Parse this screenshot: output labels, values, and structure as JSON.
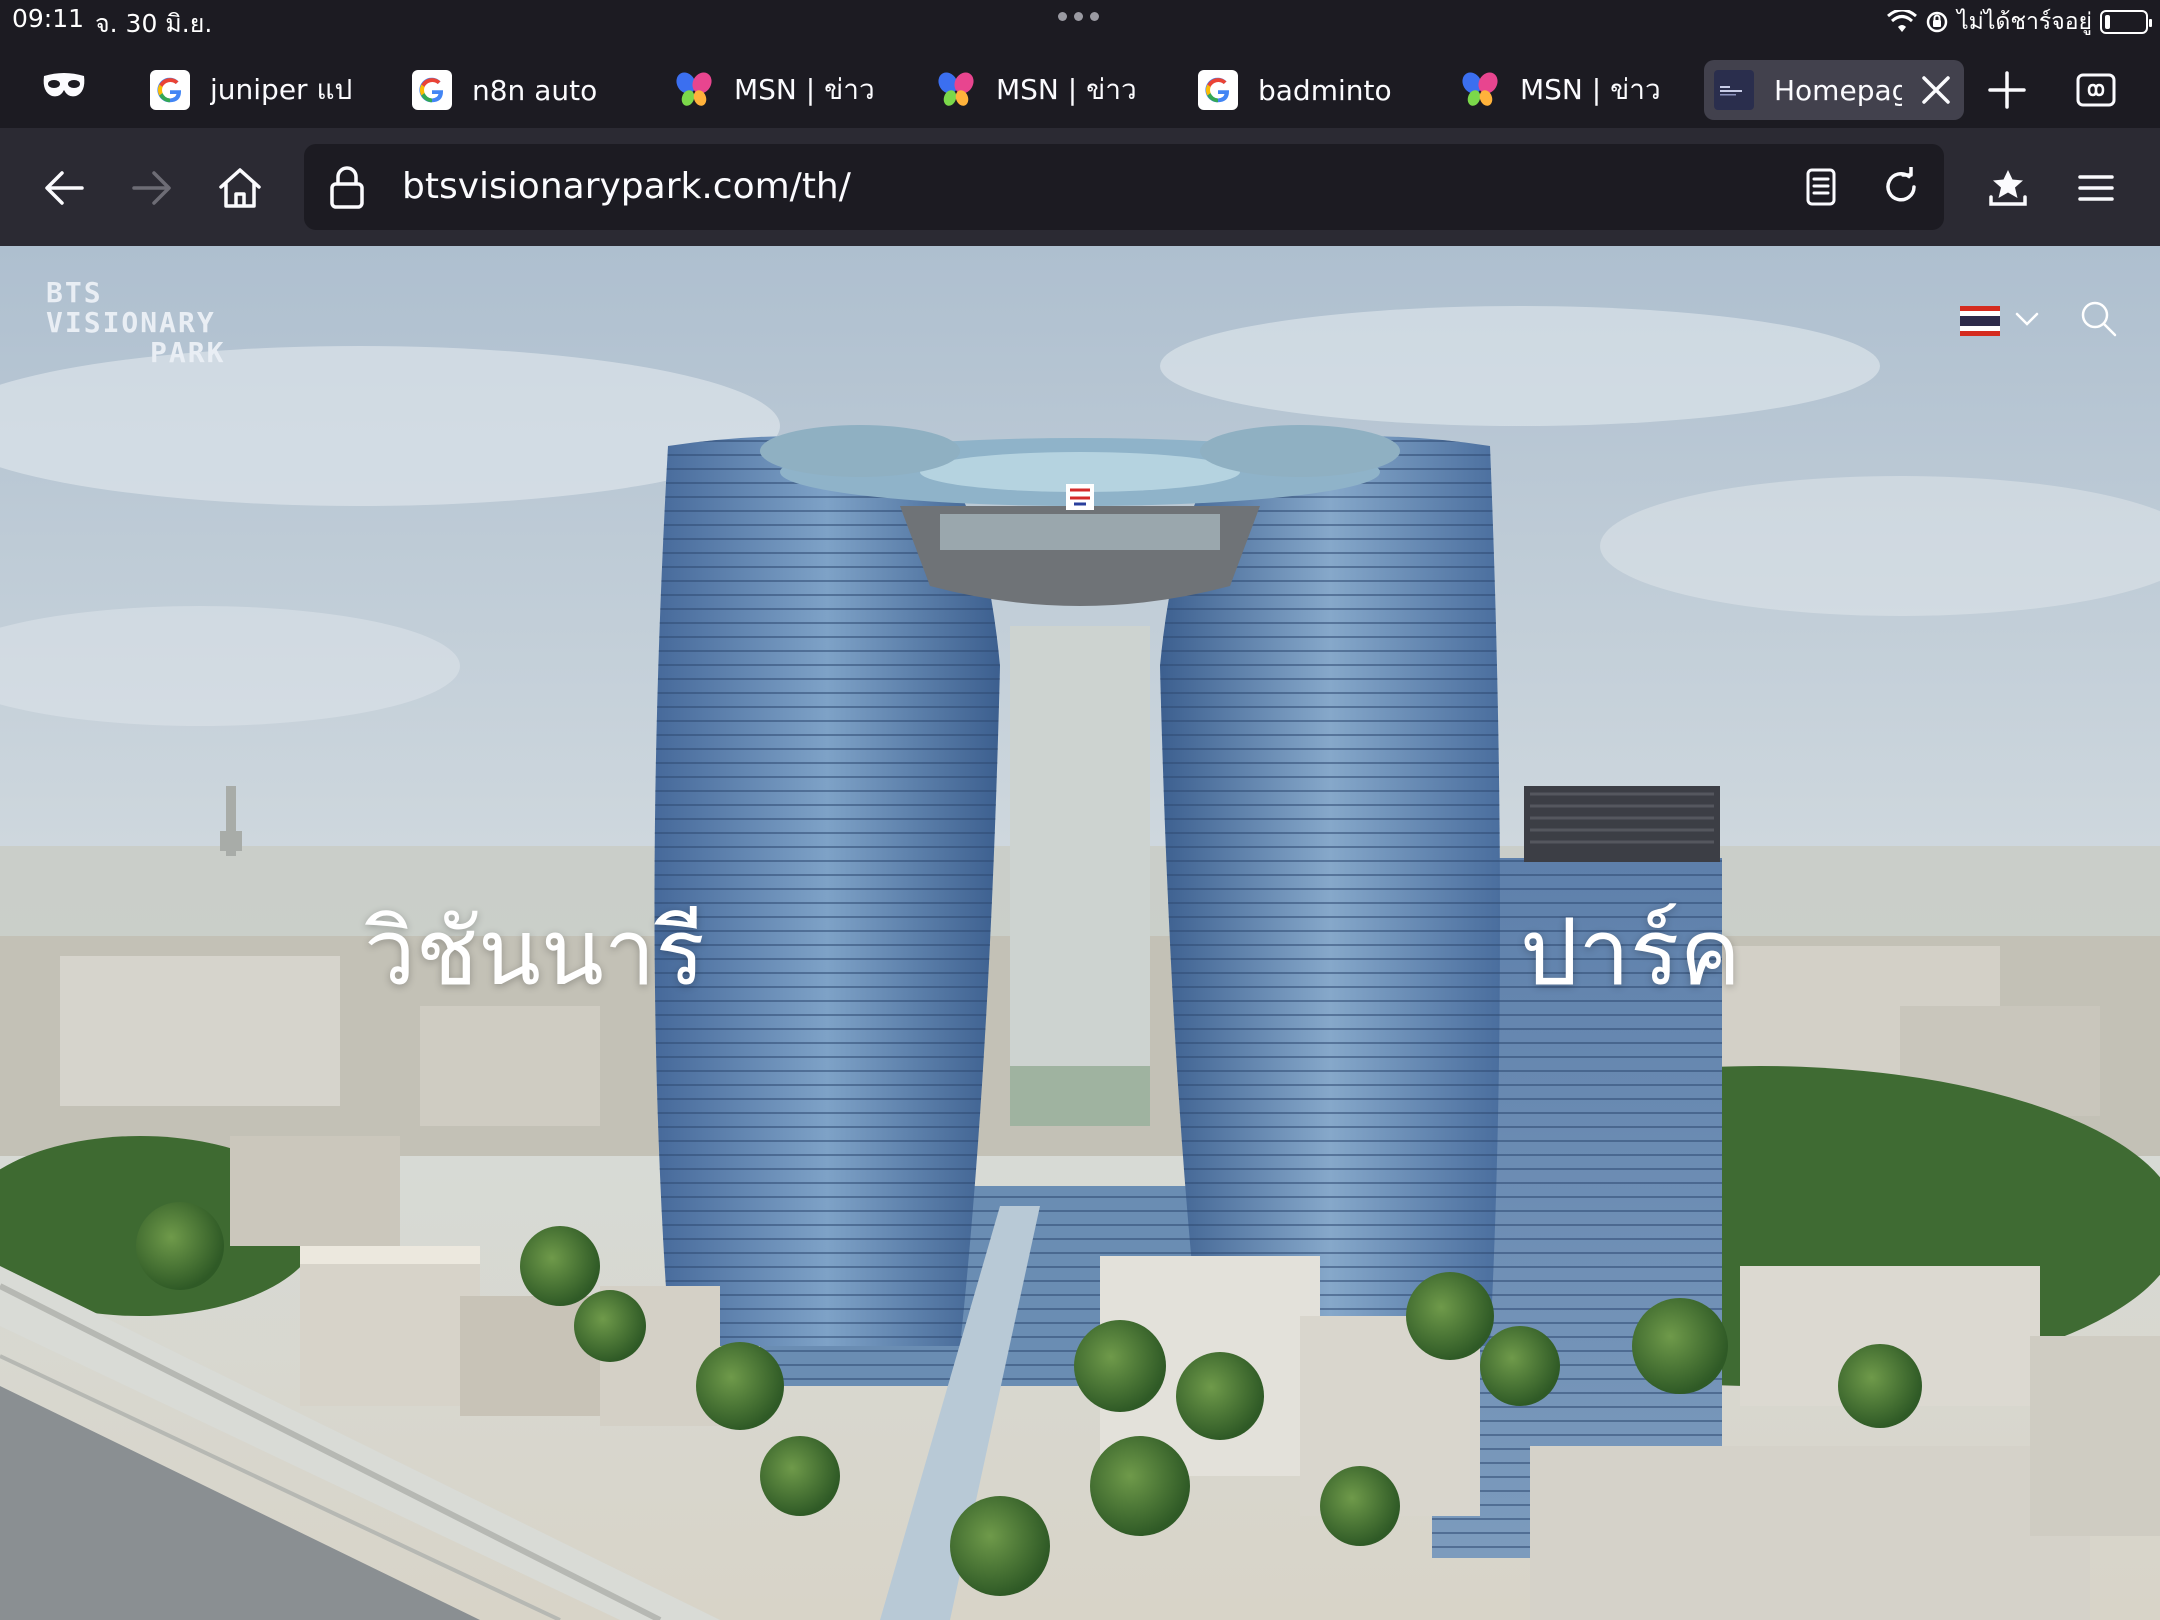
{
  "status_bar": {
    "time": "09:11",
    "date": "จ. 30 มิ.ย.",
    "charging_text": "ไม่ได้ชาร์จอยู่"
  },
  "tabs": [
    {
      "label": "juniper แป",
      "favicon": "google-icon"
    },
    {
      "label": "n8n auto",
      "favicon": "google-icon"
    },
    {
      "label": "MSN | ข่าว",
      "favicon": "msn-icon"
    },
    {
      "label": "MSN | ข่าว",
      "favicon": "msn-icon"
    },
    {
      "label": "badminto",
      "favicon": "google-icon"
    },
    {
      "label": "MSN | ข่าว",
      "favicon": "msn-icon"
    },
    {
      "label": "Homepag",
      "favicon": "bts-icon",
      "active": true
    }
  ],
  "toolbar": {
    "url": "btsvisionarypark.com/th/"
  },
  "site": {
    "logo_line1": "BTS",
    "logo_line2": "VISIONARY",
    "logo_line3": "PARK",
    "hero_left": "วิชันนารี",
    "hero_right": "ปาร์ค",
    "language_flag": "thailand-flag-icon"
  },
  "colors": {
    "browser_bg": "#1c1b22",
    "toolbar_bg": "#2b2a33",
    "active_tab_bg": "#42414d",
    "sky": "#b9c9d6",
    "tower_glass": "#5c83b0"
  }
}
